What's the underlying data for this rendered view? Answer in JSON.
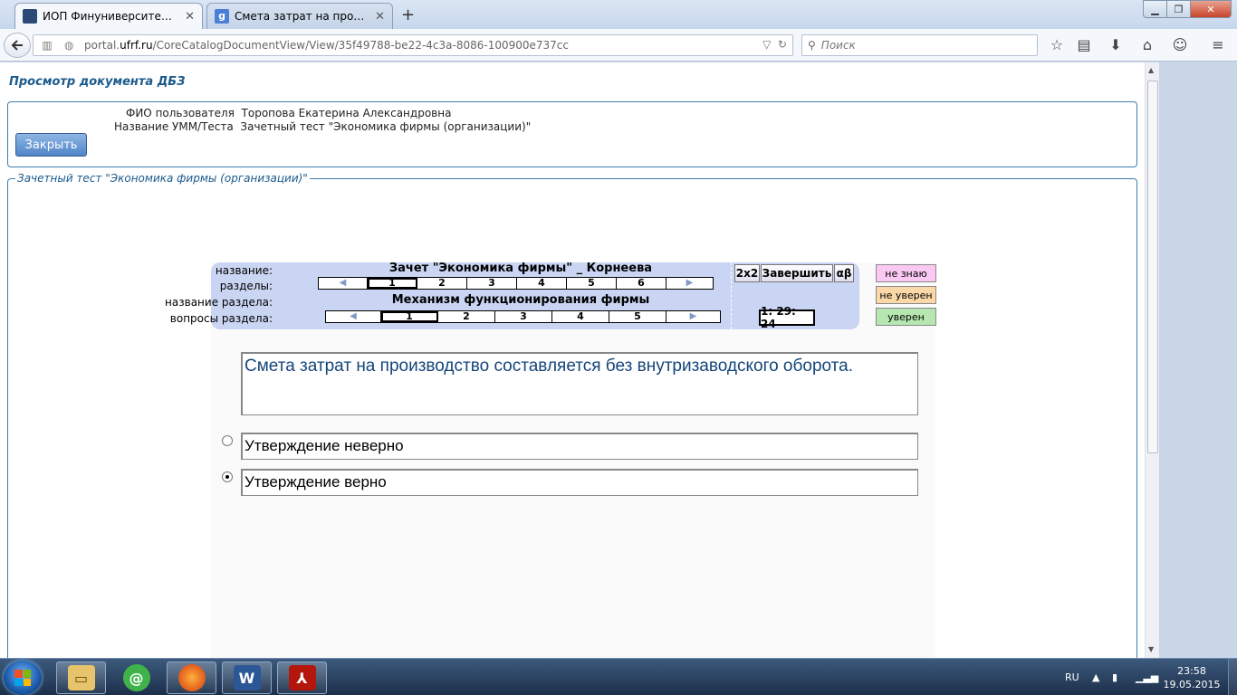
{
  "browser": {
    "tabs": [
      {
        "title": "ИОП Финуниверситета : ...",
        "active": true
      },
      {
        "title": "Смета затрат на производ...",
        "active": false
      }
    ],
    "url_prefix": "portal.",
    "url_host": "ufrf.ru",
    "url_path": "/CoreCatalogDocumentView/View/35f49788-be22-4c3a-8086-100900e737cc",
    "search_placeholder": "Поиск",
    "new_tab": "+",
    "tab_close": "✕"
  },
  "page": {
    "title": "Просмотр документа ДБЗ",
    "user_label": "ФИО пользователя",
    "user_value": "Торопова Екатерина Александровна",
    "test_label": "Название УММ/Теста",
    "test_value": "Зачетный тест \"Экономика фирмы (организации)\"",
    "close_button": "Закрыть",
    "section_legend": "Зачетный тест \"Экономика фирмы (организации)\""
  },
  "test": {
    "name_label": "название:",
    "name_value": "Зачет \"Экономика фирмы\" _ Корнеева",
    "sections_label": "разделы:",
    "sections": [
      "1",
      "2",
      "3",
      "4",
      "5",
      "6"
    ],
    "section_selected": "1",
    "section_name_label": "название раздела:",
    "section_name_value": "Механизм функционирования  фирмы",
    "questions_label": "вопросы раздела:",
    "questions": [
      "1",
      "2",
      "3",
      "4",
      "5"
    ],
    "question_selected": "1",
    "btn_2x2": "2x2",
    "btn_finish": "Завершить",
    "btn_alpha": "αβ",
    "timer": "1: 29: 24",
    "confidence": {
      "dont_know": "не знаю",
      "not_sure": "не уверен",
      "sure": "уверен"
    },
    "question_text": "Смета затрат на производство составляется без внутризаводского оборота.",
    "answers": [
      {
        "text": "Утверждение неверно",
        "selected": false
      },
      {
        "text": "Утверждение верно",
        "selected": true
      }
    ]
  },
  "taskbar": {
    "lang": "RU",
    "time": "23:58",
    "date": "19.05.2015"
  },
  "colors": {
    "accent_blue": "#1b5a8c",
    "panel_bg": "#c9d5f2",
    "dont_know_bg": "#f9c9f3",
    "not_sure_bg": "#fbd8a8",
    "sure_bg": "#b6e7b0"
  }
}
